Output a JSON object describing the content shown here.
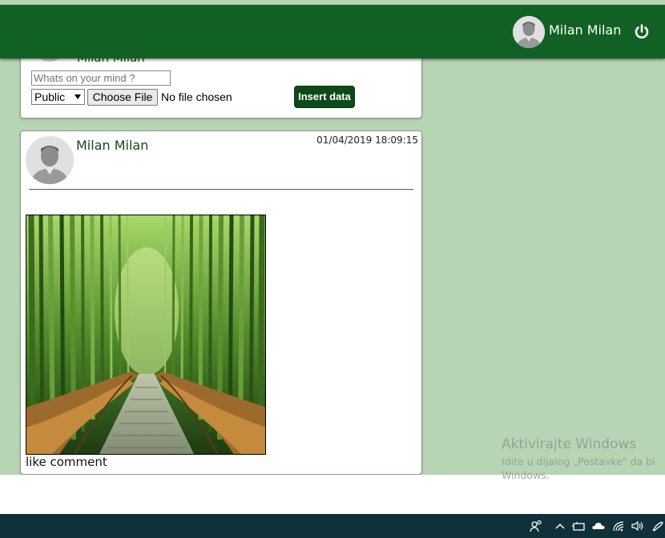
{
  "header": {
    "user_name": "Milan Milan",
    "avatar_icon": "user-avatar-icon",
    "logout_icon": "power-icon"
  },
  "composer": {
    "author_name": "Milan Milan",
    "text_placeholder": "Whats on your mind ?",
    "visibility_selected": "Public",
    "choose_file_label": "Choose File",
    "file_status": "No file chosen",
    "submit_label": "Insert data"
  },
  "post": {
    "author_name": "Milan Milan",
    "timestamp": "01/04/2019 18:09:15",
    "image_icon": "bamboo-forest-photo",
    "like_label": "like",
    "comment_label": "comment"
  },
  "watermark": {
    "title": "Aktivirajte Windows",
    "line1": "Idite u dijalog „Postavke\" da bi",
    "line2": "Windows."
  },
  "taskbar": {
    "icons": [
      "people-icon",
      "chevron-up-icon",
      "network-device-icon",
      "onedrive-cloud-icon",
      "wifi-icon",
      "volume-icon",
      "pen-icon"
    ]
  },
  "colors": {
    "header_bg": "#116124",
    "page_bg": "#b7d5b5",
    "button_bg": "#0c4a18",
    "taskbar_bg": "#10303a"
  }
}
